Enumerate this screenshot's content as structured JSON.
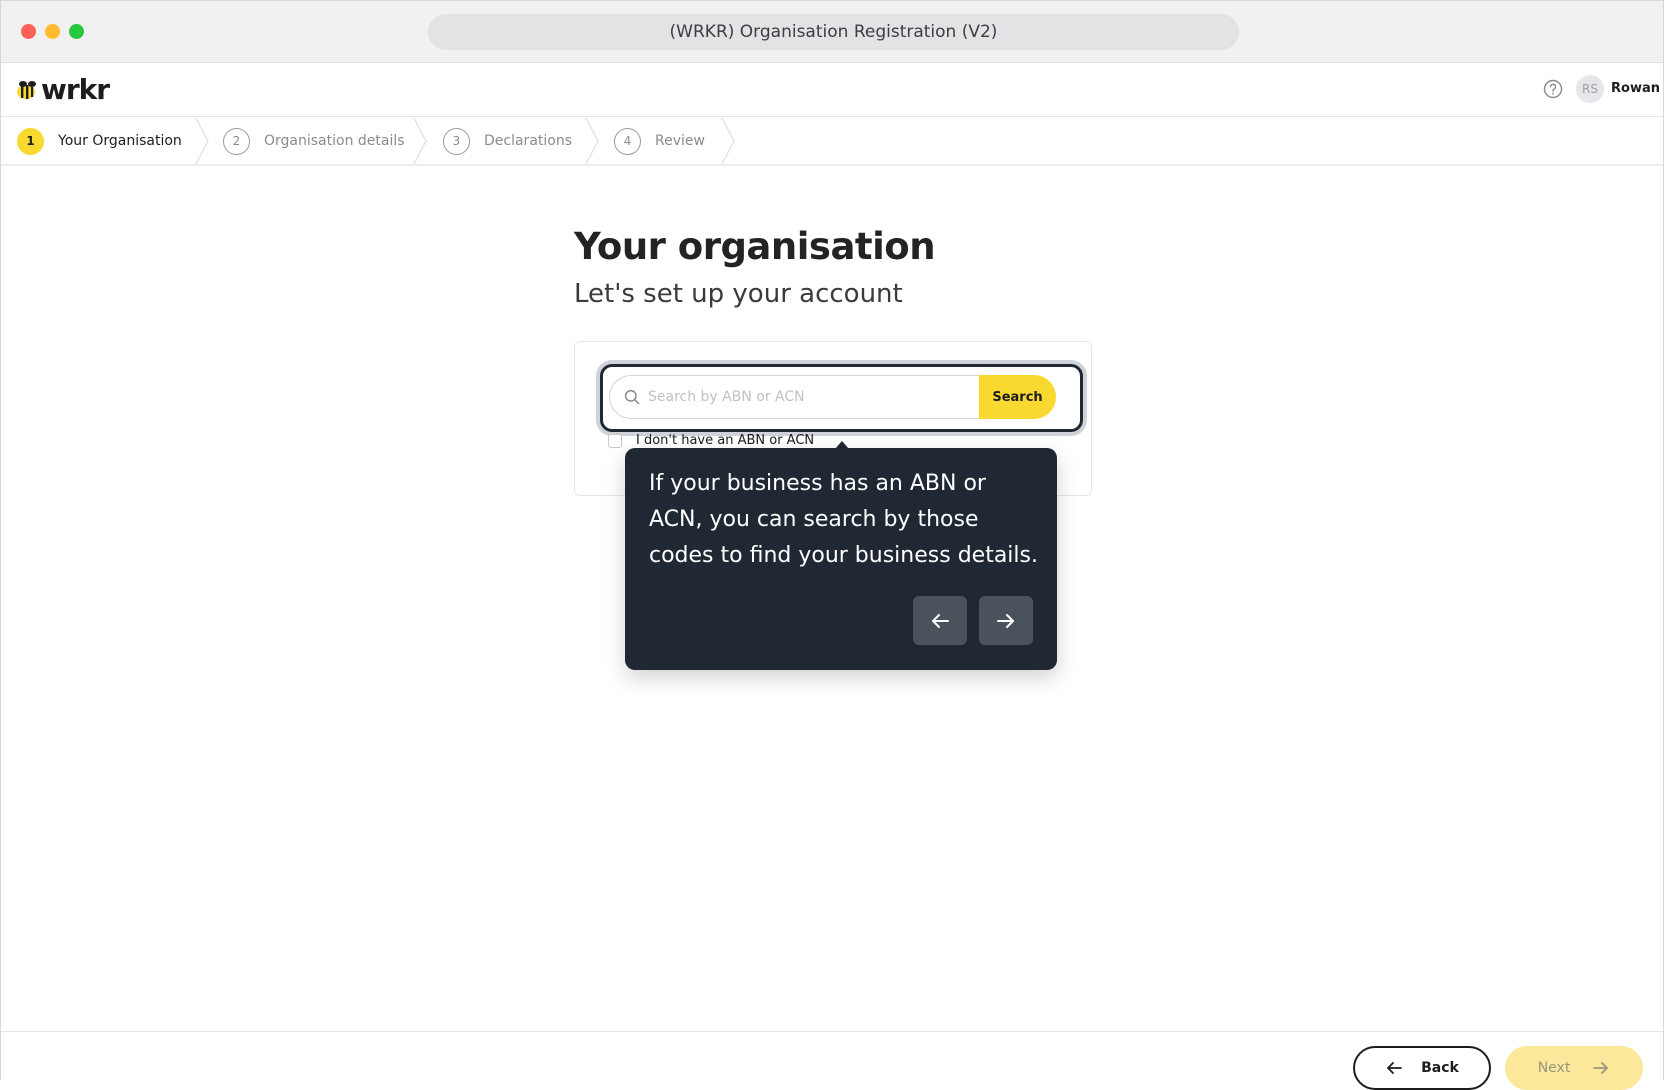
{
  "window": {
    "title": "(WRKR) Organisation Registration (V2)"
  },
  "header": {
    "logo_text": "wrkr",
    "user_initials": "RS",
    "user_name": "Rowan"
  },
  "stepper": {
    "steps": [
      {
        "number": "1",
        "label": "Your Organisation",
        "active": true
      },
      {
        "number": "2",
        "label": "Organisation details",
        "active": false
      },
      {
        "number": "3",
        "label": "Declarations",
        "active": false
      },
      {
        "number": "4",
        "label": "Review",
        "active": false
      }
    ]
  },
  "main": {
    "title": "Your organisation",
    "subtitle": "Let's set up your account",
    "search": {
      "placeholder": "Search by ABN or ACN",
      "value": "",
      "button_label": "Search"
    },
    "no_abn_checkbox": {
      "label": "I don't have an ABN or ACN",
      "checked": false
    }
  },
  "tooltip": {
    "text": "If your business has an ABN or ACN, you can search by those codes to find your business details."
  },
  "footer": {
    "back_label": "Back",
    "next_label": "Next"
  },
  "colors": {
    "accent_yellow": "#f9d92f",
    "tooltip_bg": "#1f2833",
    "next_disabled": "#fbe89a"
  }
}
